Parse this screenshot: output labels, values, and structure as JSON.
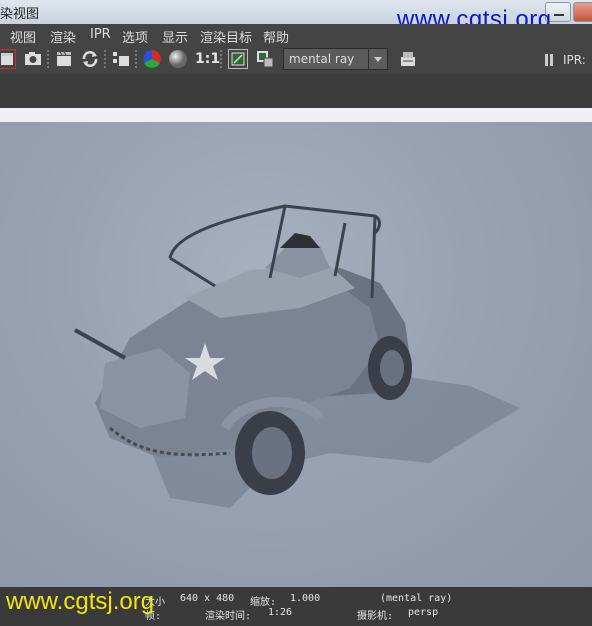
{
  "window": {
    "title": "染视图"
  },
  "watermark": {
    "top": "www.cgtsj.org",
    "bottom": "www.cgtsj.org"
  },
  "menu": {
    "items": [
      "视图",
      "渲染",
      "IPR",
      "选项",
      "显示",
      "渲染目标",
      "帮助"
    ]
  },
  "toolbar": {
    "icons": [
      "clapper-red-icon",
      "snapshot-camera-icon",
      "clapper-icon",
      "refresh-icon",
      "region-render-icon",
      "rgb-channel-icon",
      "gray-sphere-icon",
      "frame-icon",
      "keep-image-icon"
    ],
    "ratio_label": "1:1",
    "renderer": "mental ray",
    "ipr_label": "IPR: ",
    "colors": {
      "rgb_red": "#d32b2b",
      "rgb_green": "#2bab3a",
      "rgb_blue": "#2f4fd8"
    }
  },
  "status": {
    "size_label": "大小",
    "size_value": "640 x 480",
    "zoom_label": "缩放:",
    "zoom_value": "1.000",
    "renderer": "(mental ray)",
    "frame_label": "帧:",
    "time_label": "渲染时间:",
    "time_value": "1:26",
    "camera_label": "摄影机:",
    "camera_value": "persp"
  },
  "scene": {
    "subject": "armored-car-render"
  }
}
